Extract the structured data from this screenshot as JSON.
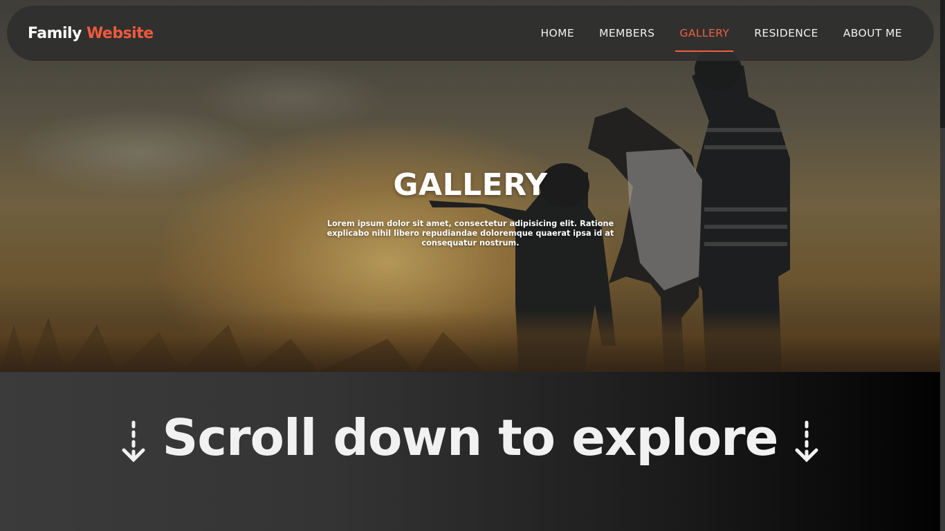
{
  "brand": {
    "first": "Family",
    "second": "Website"
  },
  "nav": {
    "items": [
      {
        "label": "HOME"
      },
      {
        "label": "MEMBERS"
      },
      {
        "label": "GALLERY"
      },
      {
        "label": "RESIDENCE"
      },
      {
        "label": "ABOUT ME"
      }
    ],
    "active": "GALLERY"
  },
  "hero": {
    "title": "GALLERY",
    "subtitle": "Lorem ipsum dolor sit amet, consectetur adipisicing elit. Ratione explicabo nihil libero repudiandae doloremque quaerat ipsa id at consequatur nostrum."
  },
  "explore": {
    "label": "Scroll down to explore"
  },
  "colors": {
    "accent": "#ef5a3c",
    "nav_background": "#2d2d2d",
    "text_light": "#ffffff"
  }
}
